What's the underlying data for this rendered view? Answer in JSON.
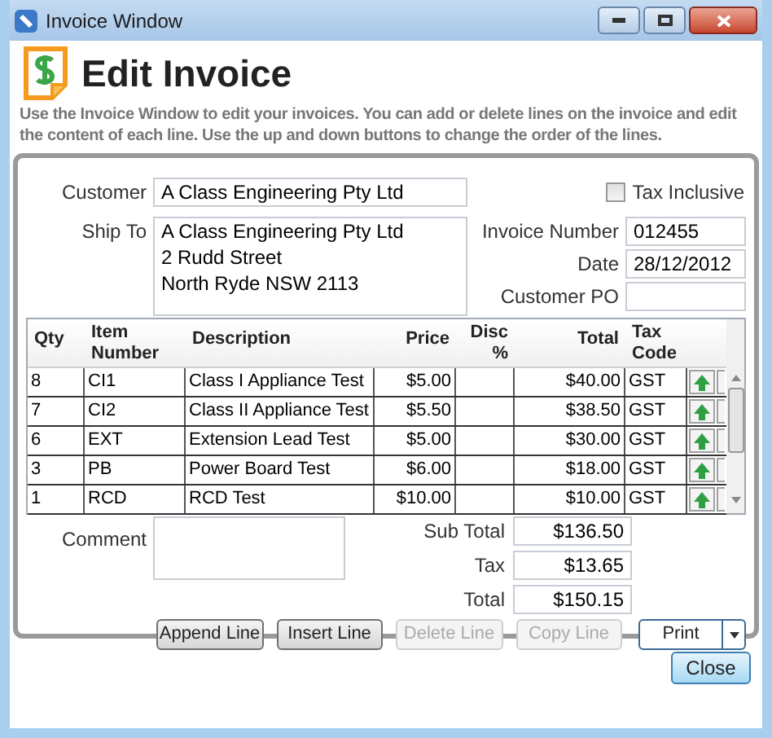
{
  "window": {
    "title": "Invoice Window"
  },
  "header": {
    "title": "Edit Invoice",
    "description": "Use the Invoice Window to edit your invoices. You can add or delete lines on the invoice and edit the content of each line. Use the up and down buttons to change the order of the lines."
  },
  "customer": {
    "label": "Customer",
    "value": "A Class Engineering Pty Ltd"
  },
  "tax_inclusive": {
    "label": "Tax Inclusive",
    "checked": false
  },
  "ship_to": {
    "label": "Ship To",
    "lines": [
      "A Class Engineering Pty Ltd",
      "2 Rudd Street",
      "North Ryde NSW 2113"
    ]
  },
  "invoice_number": {
    "label": "Invoice Number",
    "value": "012455"
  },
  "date": {
    "label": "Date",
    "value": "28/12/2012"
  },
  "customer_po": {
    "label": "Customer PO"
  },
  "table": {
    "columns": [
      "Qty",
      "Item Number",
      "Description",
      "Price",
      "Disc %",
      "Total",
      "Tax Code"
    ],
    "rows": [
      {
        "qty": "8",
        "item": "CI1",
        "description": "Class I Appliance Test",
        "price": "$5.00",
        "disc": "",
        "total": "$40.00",
        "tax": "GST"
      },
      {
        "qty": "7",
        "item": "CI2",
        "description": "Class II Appliance Test",
        "price": "$5.50",
        "disc": "",
        "total": "$38.50",
        "tax": "GST"
      },
      {
        "qty": "6",
        "item": "EXT",
        "description": "Extension Lead Test",
        "price": "$5.00",
        "disc": "",
        "total": "$30.00",
        "tax": "GST"
      },
      {
        "qty": "3",
        "item": "PB",
        "description": "Power Board Test",
        "price": "$6.00",
        "disc": "",
        "total": "$18.00",
        "tax": "GST"
      },
      {
        "qty": "1",
        "item": "RCD",
        "description": "RCD Test",
        "price": "$10.00",
        "disc": "",
        "total": "$10.00",
        "tax": "GST"
      }
    ]
  },
  "comment": {
    "label": "Comment"
  },
  "totals": [
    {
      "label": "Sub Total",
      "value": "$136.50"
    },
    {
      "label": "Tax",
      "value": "$13.65"
    },
    {
      "label": "Total",
      "value": "$150.15"
    }
  ],
  "buttons": [
    {
      "label": "Append Line",
      "disabled": false
    },
    {
      "label": "Insert Line",
      "disabled": false
    },
    {
      "label": "Delete Line",
      "disabled": true
    },
    {
      "label": "Copy Line",
      "disabled": true
    }
  ],
  "print_button": {
    "label": "Print"
  },
  "close_button": {
    "label": "Close"
  }
}
